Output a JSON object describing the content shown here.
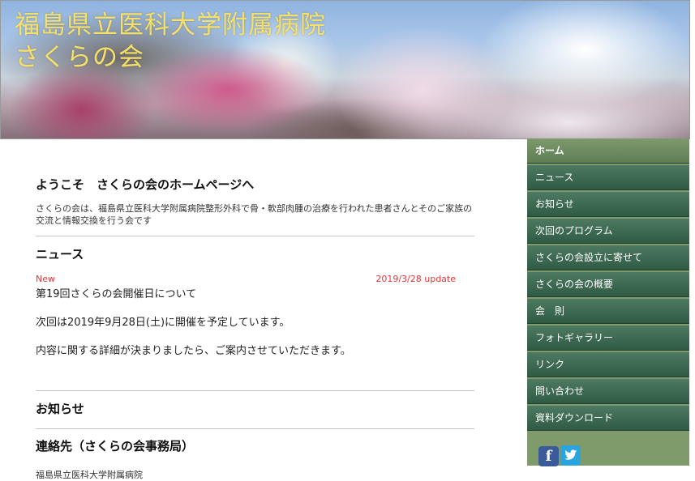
{
  "header": {
    "title_line1": "福島県立医科大学附属病院",
    "title_line2": "さくらの会"
  },
  "main": {
    "welcome": {
      "title": "ようこそ　さくらの会のホームページへ",
      "text": "さくらの会は、福島県立医科大学附属病院整形外科で骨・軟部肉腫の治療を行われた患者さんとそのご家族の交流と情報交換を行う会です"
    },
    "news": {
      "title": "ニュース",
      "new_badge": "New",
      "update_date": "2019/3/28 update",
      "heading": "第19回さくらの会開催日について",
      "paragraph1": "次回は2019年9月28日(土)に開催を予定しています。",
      "paragraph2": "内容に関する詳細が決まりましたら、ご案内させていただきます。"
    },
    "notice": {
      "title": "お知らせ"
    },
    "contact": {
      "title": "連絡先（さくらの会事務局）",
      "line1": "福島県立医科大学附属病院"
    }
  },
  "sidebar": {
    "items": [
      {
        "label": "ホーム",
        "active": true
      },
      {
        "label": "ニュース"
      },
      {
        "label": "お知らせ"
      },
      {
        "label": "次回のプログラム"
      },
      {
        "label": "さくらの会設立に寄せて"
      },
      {
        "label": "さくらの会の概要"
      },
      {
        "label": "会　則"
      },
      {
        "label": "フォトギャラリー"
      },
      {
        "label": "リンク"
      },
      {
        "label": "問い合わせ"
      },
      {
        "label": "資料ダウンロード"
      }
    ],
    "social": {
      "facebook_label": "f",
      "icons": [
        "facebook-icon",
        "twitter-icon"
      ]
    }
  },
  "colors": {
    "title_yellow": "#f4e06b",
    "nav_green": "#2f5a43",
    "nav_active": "#6f8d60",
    "sidebar_bg": "#7f9a6b",
    "update_red": "#e03a3a",
    "facebook_blue": "#3b5a99",
    "twitter_blue": "#2aa4dc"
  }
}
